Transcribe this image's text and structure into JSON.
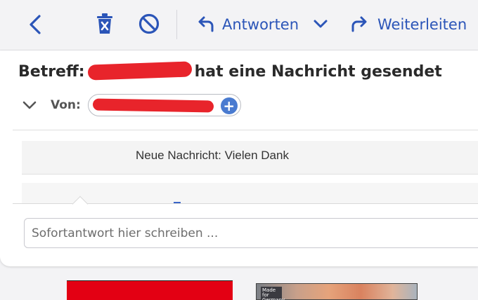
{
  "toolbar": {
    "reply_label": "Antworten",
    "forward_label": "Weiterleiten"
  },
  "message": {
    "subject_prefix": "Betreff:",
    "subject_suffix": "hat eine Nachricht gesendet",
    "from_label": "Von:",
    "body_text": "Neue Nachricht: Vielen Dank"
  },
  "quick_reply": {
    "placeholder": "Sofortantwort hier schreiben ..."
  },
  "ads": {
    "badge_text": "Made for Germany"
  },
  "colors": {
    "accent": "#2b55b8",
    "redaction": "#e8242b"
  }
}
